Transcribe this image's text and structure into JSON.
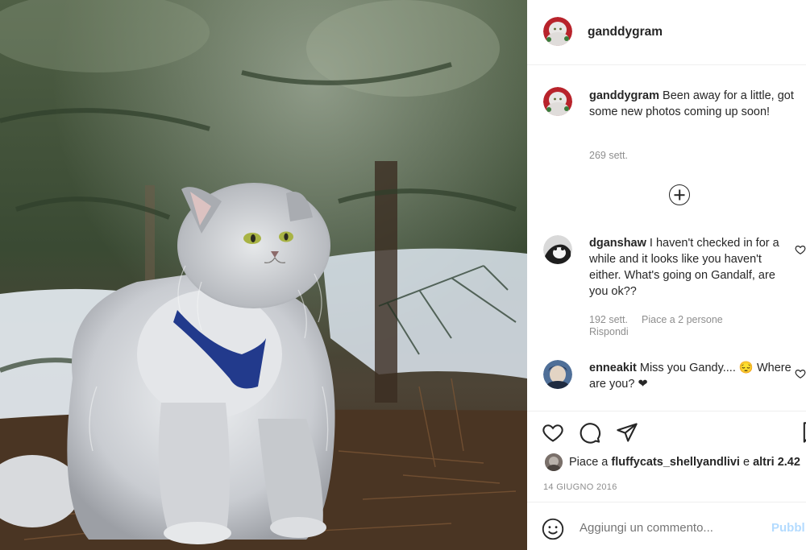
{
  "post": {
    "owner": "ganddygram",
    "caption_user": "ganddygram",
    "caption_text": " Been away for a little, got some new photos coming up soon!",
    "caption_time": "269 sett.",
    "image_icon": "persian-cat-photo"
  },
  "comments": [
    {
      "user": "dganshaw",
      "text": " I haven't checked in for a while and it looks like you haven't either. What's going on Gandalf, are you ok??",
      "time": "192 sett.",
      "likes": "Piace a 2 persone",
      "reply": "Rispondi"
    },
    {
      "user": "enneakit",
      "text": " Miss you Gandy.... 😔 Where are you? ❤"
    }
  ],
  "actions": {
    "like_icon": "heart-icon",
    "comment_icon": "comment-icon",
    "share_icon": "share-icon",
    "save_icon": "bookmark-icon"
  },
  "likes": {
    "prefix": "Piace a ",
    "user": "fluffycats_shellyandlivi",
    "middle": " e ",
    "others": "altri 2.42"
  },
  "date": "14 GIUGNO 2016",
  "add_comment": {
    "placeholder": "Aggiungi un commento...",
    "post_label": "Pubbl"
  },
  "colors": {
    "text": "#262626",
    "secondary": "#8e8e8e",
    "post_disabled": "#b3dbff",
    "divider": "#efefef"
  }
}
